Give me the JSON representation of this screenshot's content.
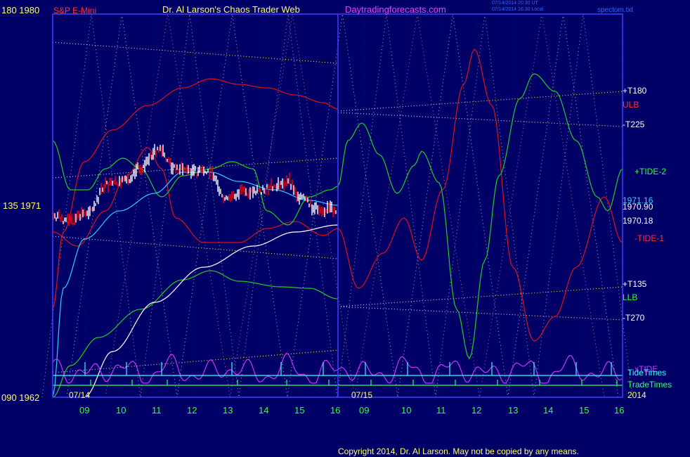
{
  "header": {
    "instrument": "S&P E-Mini",
    "title": "Dr. Al Larson's Chaos Trader Web",
    "site": "Daytradingforecasts.com",
    "timestamp_1": "07/14/2014 20:30 UT",
    "timestamp_2": "07/14/2014 16:30 Local",
    "filename": "spectom.txt"
  },
  "left_axis": {
    "top": "180  1980",
    "middle": "135  1971",
    "bottom": "090  1962"
  },
  "date_labels": [
    "07/14",
    "07/15"
  ],
  "year_label": "2014",
  "hour_ticks": [
    "09",
    "10",
    "11",
    "12",
    "13",
    "14",
    "15",
    "16",
    "09",
    "10",
    "11",
    "12",
    "13",
    "14",
    "15",
    "16"
  ],
  "right_labels": {
    "t180": "+T180",
    "ulb": "ULB",
    "t225": "-T225",
    "tide2": "+TIDE-2",
    "p1": "1971.16",
    "p2": "1970.90",
    "p3": "1970.18",
    "tide1": "-TIDE-1",
    "t135": "+T135",
    "llb": "LLB",
    "t270": "-T270",
    "xtide": "xTIDE",
    "tidetimes": "TideTimes",
    "tradetimes": "TradeTimes"
  },
  "footer": "Copyright 2014, Dr. Al Larson. May not be copied by any means.",
  "colors": {
    "background": "#000066",
    "frame": "#4040ff",
    "price_up": "#ffffff",
    "price_down": "#ff0000",
    "red_curve": "#dd1111",
    "green_curve": "#22cc22",
    "cyan_curve": "#33ccff",
    "white_curve": "#ffffff",
    "magenta_curve": "#cc33ff",
    "yellow_lines": "#ffff66",
    "tidetimes": "#33ffff",
    "tradetimes": "#33ff66"
  },
  "chart_data": {
    "type": "line",
    "title": "S&P E-Mini",
    "y_axis_left": {
      "price_range": [
        1962,
        1980
      ],
      "angle_range": [
        90,
        180
      ]
    },
    "x": [
      "07/14 09",
      "10",
      "11",
      "12",
      "13",
      "14",
      "15",
      "16",
      "07/15 09",
      "10",
      "11",
      "12",
      "13",
      "14",
      "15",
      "16"
    ],
    "price_readings": [
      1971.16,
      1970.9,
      1970.18
    ],
    "series_names": [
      "+T180",
      "-T225",
      "+TIDE-2",
      "-TIDE-1",
      "+T135",
      "-T270",
      "ULB",
      "LLB",
      "xTIDE",
      "TideTimes",
      "TradeTimes"
    ]
  }
}
